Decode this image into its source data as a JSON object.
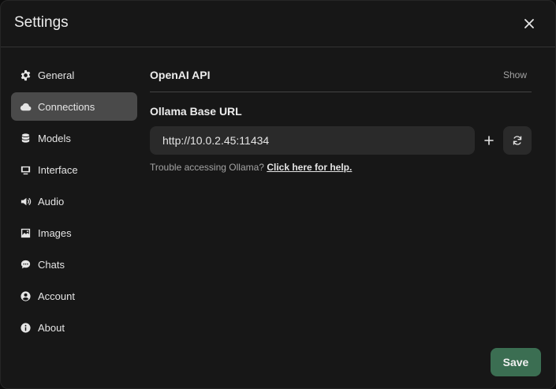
{
  "dialog": {
    "title": "Settings",
    "save_label": "Save"
  },
  "sidebar": {
    "items": [
      {
        "label": "General",
        "icon": "gear-icon",
        "active": false
      },
      {
        "label": "Connections",
        "icon": "cloud-icon",
        "active": true
      },
      {
        "label": "Models",
        "icon": "database-icon",
        "active": false
      },
      {
        "label": "Interface",
        "icon": "monitor-icon",
        "active": false
      },
      {
        "label": "Audio",
        "icon": "speaker-icon",
        "active": false
      },
      {
        "label": "Images",
        "icon": "image-icon",
        "active": false
      },
      {
        "label": "Chats",
        "icon": "chat-bubble-icon",
        "active": false
      },
      {
        "label": "Account",
        "icon": "user-circle-icon",
        "active": false
      },
      {
        "label": "About",
        "icon": "info-icon",
        "active": false
      }
    ]
  },
  "connections": {
    "openai_title": "OpenAI API",
    "show_label": "Show",
    "ollama_label": "Ollama Base URL",
    "ollama_url": "http://10.0.2.45:11434",
    "help_text": "Trouble accessing Ollama?",
    "help_link": "Click here for help."
  },
  "colors": {
    "background": "#171717",
    "active_item": "#4a4a4a",
    "input_bg": "#2a2a2a",
    "save_button": "#3b6e52"
  }
}
